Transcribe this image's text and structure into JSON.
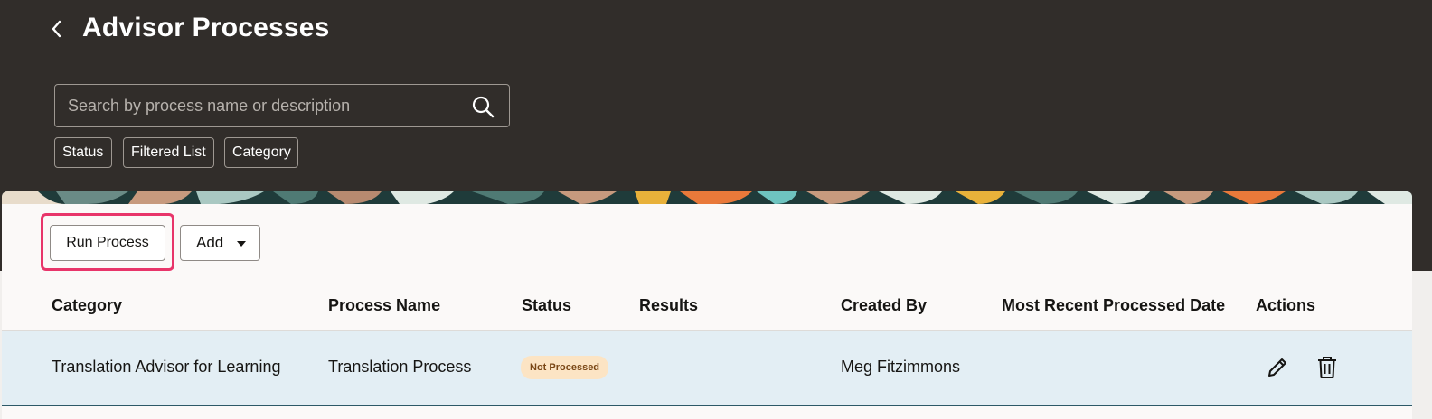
{
  "header": {
    "title": "Advisor Processes",
    "back_icon": "chevron-left-icon"
  },
  "search": {
    "placeholder": "Search by process name or description",
    "value": "",
    "icon": "search-icon"
  },
  "filters": [
    {
      "label": "Status"
    },
    {
      "label": "Filtered List"
    },
    {
      "label": "Category"
    }
  ],
  "toolbar": {
    "run_label": "Run Process",
    "add_label": "Add",
    "add_icon": "caret-down-icon",
    "highlight_color": "#e8356a"
  },
  "table": {
    "columns": [
      "Category",
      "Process Name",
      "Status",
      "Results",
      "Created By",
      "Most Recent Processed Date",
      "Actions"
    ],
    "rows": [
      {
        "category": "Translation Advisor for Learning",
        "process_name": "Translation Process",
        "status": "Not Processed",
        "results": "",
        "created_by": "Meg Fitzimmons",
        "processed_date": "",
        "actions": [
          "edit-icon",
          "trash-icon"
        ]
      }
    ]
  },
  "colors": {
    "header_bg": "#312d2a",
    "row_selected_bg": "#e3eef4",
    "status_badge_bg": "#fce4c4",
    "status_badge_text": "#7a4716"
  }
}
